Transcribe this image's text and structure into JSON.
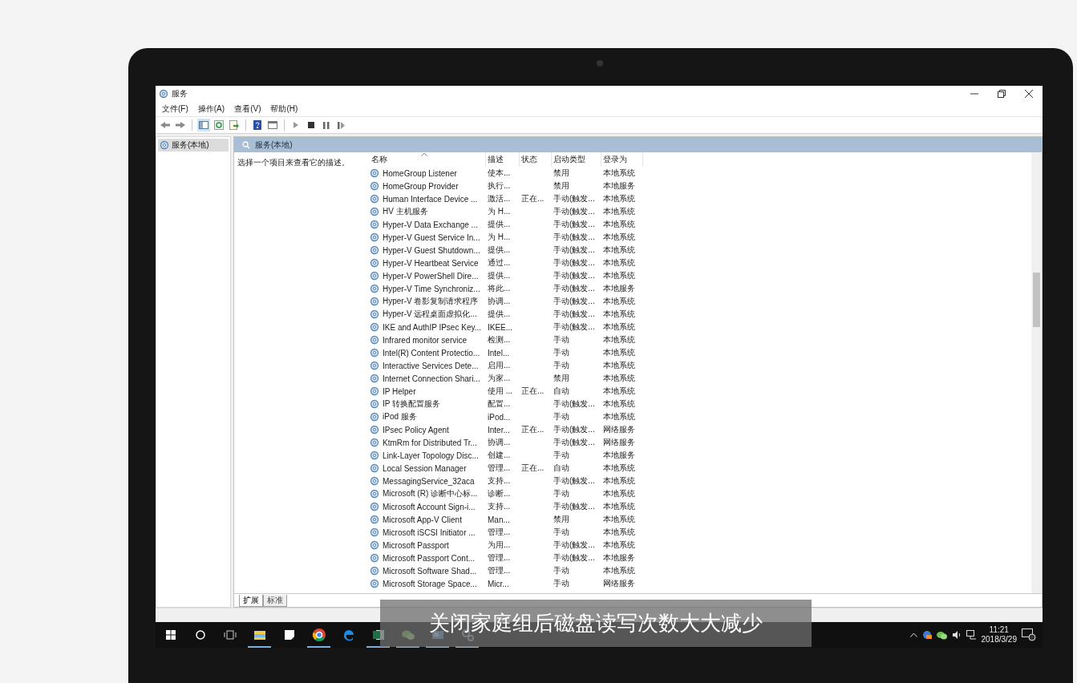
{
  "window": {
    "title": "服务"
  },
  "menu": [
    "文件(F)",
    "操作(A)",
    "查看(V)",
    "帮助(H)"
  ],
  "tree": [
    {
      "label": "服务(本地)",
      "selected": true
    }
  ],
  "pane": {
    "title": "服务(本地)",
    "description": "选择一个项目来查看它的描述。"
  },
  "table": {
    "columns": [
      "名称",
      "描述",
      "状态",
      "启动类型",
      "登录为"
    ],
    "rows": [
      {
        "name": "HomeGroup Listener",
        "description": "使本...",
        "startup": "禁用",
        "logon": "本地系统"
      },
      {
        "name": "HomeGroup Provider",
        "description": "执行...",
        "startup": "禁用",
        "logon": "本地服务"
      },
      {
        "name": "Human Interface Device ...",
        "description": "激活...",
        "status": "正在...",
        "startup": "手动(触发...",
        "logon": "本地系统"
      },
      {
        "name": "HV 主机服务",
        "description": "为 H...",
        "startup": "手动(触发...",
        "logon": "本地系统"
      },
      {
        "name": "Hyper-V Data Exchange ...",
        "description": "提供...",
        "startup": "手动(触发...",
        "logon": "本地系统"
      },
      {
        "name": "Hyper-V Guest Service In...",
        "description": "为 H...",
        "startup": "手动(触发...",
        "logon": "本地系统"
      },
      {
        "name": "Hyper-V Guest Shutdown...",
        "description": "提供...",
        "startup": "手动(触发...",
        "logon": "本地系统"
      },
      {
        "name": "Hyper-V Heartbeat Service",
        "description": "通过...",
        "startup": "手动(触发...",
        "logon": "本地系统"
      },
      {
        "name": "Hyper-V PowerShell Dire...",
        "description": "提供...",
        "startup": "手动(触发...",
        "logon": "本地系统"
      },
      {
        "name": "Hyper-V Time Synchroniz...",
        "description": "将此...",
        "startup": "手动(触发...",
        "logon": "本地服务"
      },
      {
        "name": "Hyper-V 卷影复制请求程序",
        "description": "协调...",
        "startup": "手动(触发...",
        "logon": "本地系统"
      },
      {
        "name": "Hyper-V 远程桌面虚拟化...",
        "description": "提供...",
        "startup": "手动(触发...",
        "logon": "本地系统"
      },
      {
        "name": "IKE and AuthIP IPsec Key...",
        "description": "IKEE...",
        "startup": "手动(触发...",
        "logon": "本地系统"
      },
      {
        "name": "Infrared monitor service",
        "description": "检测...",
        "startup": "手动",
        "logon": "本地系统"
      },
      {
        "name": "Intel(R) Content Protectio...",
        "description": "Intel...",
        "startup": "手动",
        "logon": "本地系统"
      },
      {
        "name": "Interactive Services Dete...",
        "description": "启用...",
        "startup": "手动",
        "logon": "本地系统"
      },
      {
        "name": "Internet Connection Shari...",
        "description": "为家...",
        "startup": "禁用",
        "logon": "本地系统"
      },
      {
        "name": "IP Helper",
        "description": "使用 ...",
        "status": "正在...",
        "startup": "自动",
        "logon": "本地系统"
      },
      {
        "name": "IP 转换配置服务",
        "description": "配置...",
        "startup": "手动(触发...",
        "logon": "本地系统"
      },
      {
        "name": "iPod 服务",
        "description": "iPod...",
        "startup": "手动",
        "logon": "本地系统"
      },
      {
        "name": "IPsec Policy Agent",
        "description": "Inter...",
        "status": "正在...",
        "startup": "手动(触发...",
        "logon": "网络服务"
      },
      {
        "name": "KtmRm for Distributed Tr...",
        "description": "协调...",
        "startup": "手动(触发...",
        "logon": "网络服务"
      },
      {
        "name": "Link-Layer Topology Disc...",
        "description": "创建...",
        "startup": "手动",
        "logon": "本地服务"
      },
      {
        "name": "Local Session Manager",
        "description": "管理...",
        "status": "正在...",
        "startup": "自动",
        "logon": "本地系统"
      },
      {
        "name": "MessagingService_32aca",
        "description": "支持...",
        "startup": "手动(触发...",
        "logon": "本地系统"
      },
      {
        "name": "Microsoft (R) 诊断中心标...",
        "description": "诊断...",
        "startup": "手动",
        "logon": "本地系统"
      },
      {
        "name": "Microsoft Account Sign-i...",
        "description": "支持...",
        "startup": "手动(触发...",
        "logon": "本地系统"
      },
      {
        "name": "Microsoft App-V Client",
        "description": "Man...",
        "startup": "禁用",
        "logon": "本地系统"
      },
      {
        "name": "Microsoft iSCSI Initiator ...",
        "description": "管理...",
        "startup": "手动",
        "logon": "本地系统"
      },
      {
        "name": "Microsoft Passport",
        "description": "为用...",
        "startup": "手动(触发...",
        "logon": "本地系统"
      },
      {
        "name": "Microsoft Passport Cont...",
        "description": "管理...",
        "startup": "手动(触发...",
        "logon": "本地服务"
      },
      {
        "name": "Microsoft Software Shad...",
        "description": "管理...",
        "startup": "手动",
        "logon": "本地系统"
      },
      {
        "name": "Microsoft Storage Space...",
        "description": "Micr...",
        "startup": "手动",
        "logon": "网络服务"
      }
    ]
  },
  "tabs": [
    {
      "label": "扩展",
      "selected": true
    },
    {
      "label": "标准",
      "selected": false
    }
  ],
  "taskbar": {
    "apps": [
      {
        "kind": "folder",
        "running": true
      },
      {
        "kind": "note",
        "running": false
      },
      {
        "kind": "chrome",
        "running": true
      },
      {
        "kind": "edge",
        "running": false
      },
      {
        "kind": "excel",
        "running": true
      },
      {
        "kind": "chat",
        "running": true
      },
      {
        "kind": "window",
        "running": true
      },
      {
        "kind": "gear",
        "running": true
      }
    ],
    "time": "11:21",
    "date": "2018/3/29"
  },
  "subtitle": "关闭家庭组后磁盘读写次数大大减少"
}
